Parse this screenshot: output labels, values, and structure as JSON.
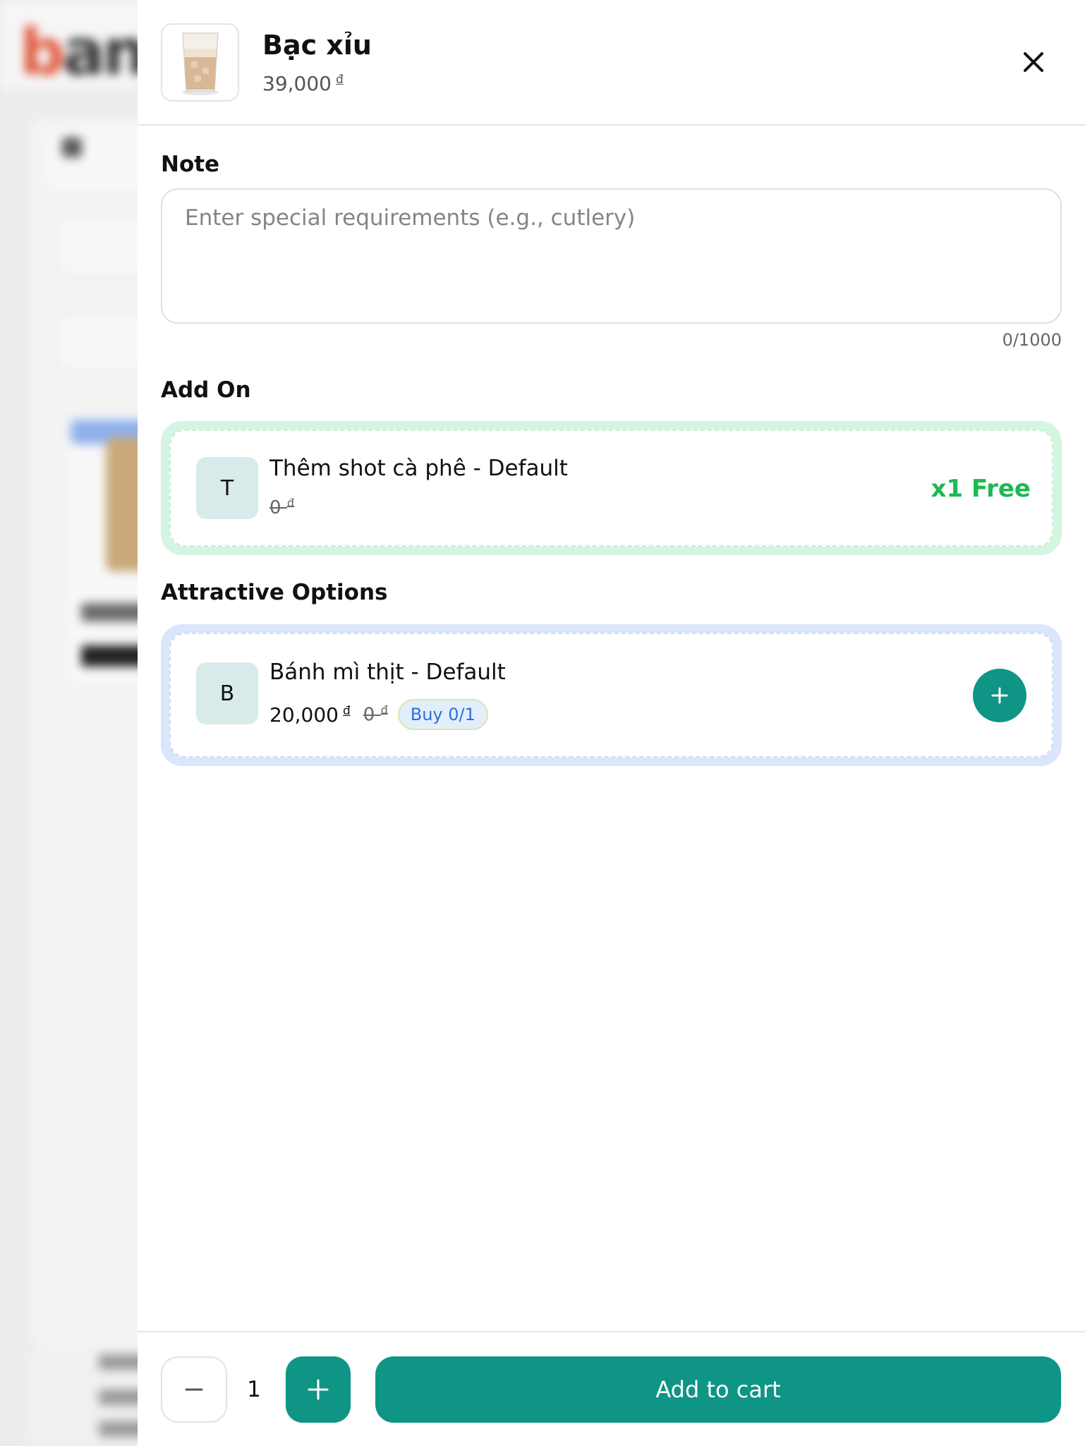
{
  "background": {
    "logo_text": "ban"
  },
  "product": {
    "name": "Bạc xỉu",
    "price": "39,000",
    "currency": "đ",
    "image_icon": "iced-coffee-icon"
  },
  "note": {
    "label": "Note",
    "placeholder": "Enter special requirements (e.g., cutlery)",
    "value": "",
    "counter": "0/1000"
  },
  "add_on": {
    "label": "Add On",
    "items": [
      {
        "letter": "T",
        "name": "Thêm shot cà phê - Default",
        "old_price": "0",
        "currency": "đ",
        "tag": "x1 Free"
      }
    ]
  },
  "attractive_options": {
    "label": "Attractive Options",
    "items": [
      {
        "letter": "B",
        "name": "Bánh mì thịt - Default",
        "price": "20,000",
        "old_price": "0",
        "currency": "đ",
        "buy_label": "Buy 0/1"
      }
    ]
  },
  "footer": {
    "quantity": "1",
    "add_to_cart_label": "Add to cart"
  },
  "colors": {
    "accent": "#0e9585",
    "free": "#1db954",
    "addon_border": "#d4f5e1",
    "option_border": "#d9e6fb",
    "buy_text": "#2f6fd6"
  }
}
